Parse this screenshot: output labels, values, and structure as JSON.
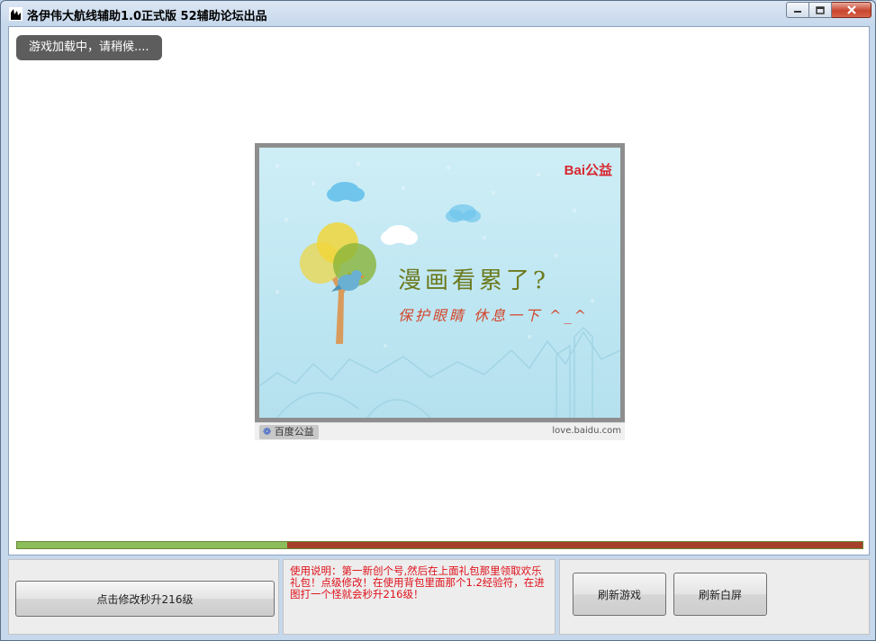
{
  "window": {
    "title": "洛伊伟大航线辅助1.0正式版   52辅助论坛出品"
  },
  "client": {
    "loading_text": "游戏加载中，请稍候...."
  },
  "ad": {
    "brand_logo": "Bai公益",
    "headline": "漫画看累了?",
    "subline": "保护眼睛 休息一下 ^_^",
    "footer_tag": "百度公益",
    "footer_url": "love.baidu.com"
  },
  "progress": {
    "fraction": 0.32,
    "fill_color": "#8bbd5a",
    "track_color": "#a6402a"
  },
  "bottom": {
    "upgrade_button": "点击修改秒升216级",
    "instructions": "使用说明：第一新创个号,然后在上面礼包那里领取欢乐礼包！点级修改！在使用背包里面那个1.2经验符，在进图打一个怪就会秒升216级！",
    "refresh_game_button": "刷新游戏",
    "refresh_white_button": "刷新白屏"
  }
}
